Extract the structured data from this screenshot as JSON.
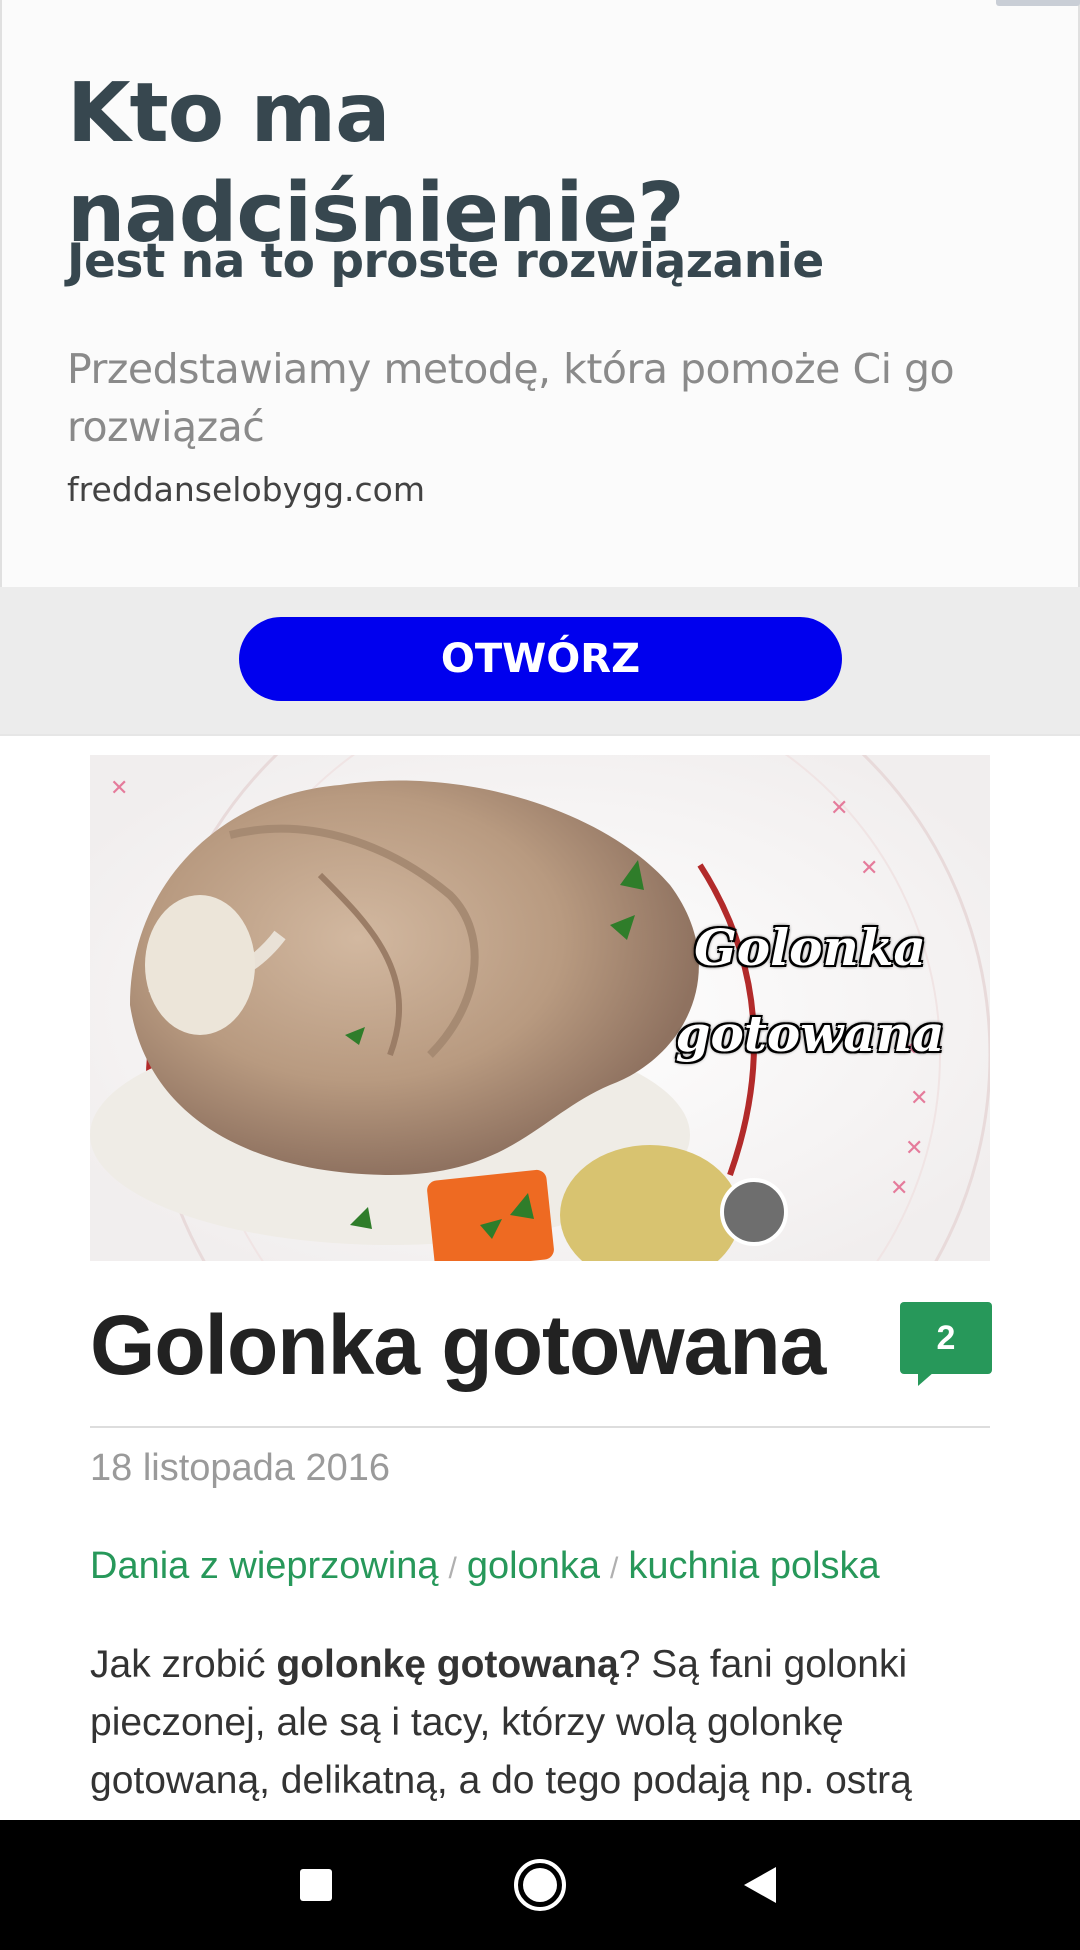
{
  "ad": {
    "title": "Kto ma nadciśnienie?",
    "subtitle": "Jest na to proste rozwiązanie",
    "description": "Przedstawiamy metodę, która pomoże Ci go rozwiązać",
    "domain": "freddanselobygg.com",
    "cta_label": "OTWÓRZ",
    "cta_color": "#0000ee"
  },
  "article": {
    "hero_caption_line1": "Golonka",
    "hero_caption_line2": "gotowana",
    "title": "Golonka gotowana",
    "comment_count": "2",
    "date": "18 listopada 2016",
    "tags": [
      "Dania z wieprzowiną",
      "golonka",
      "kuchnia polska"
    ],
    "tag_separator": "/",
    "body_intro": "Jak zrobić ",
    "body_bold": "golonkę gotowaną",
    "body_rest": "? Są fani golonki pieczonej, ale są i tacy, którzy wolą golonkę gotowaną, delikatną, a do tego podają np. ostrą",
    "accent_color": "#27985a"
  },
  "navbar": {
    "icons": [
      "recents-icon",
      "home-icon",
      "back-icon"
    ]
  }
}
